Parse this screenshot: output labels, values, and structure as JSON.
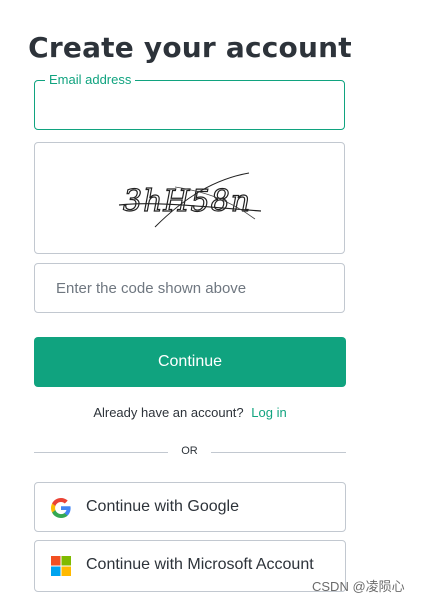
{
  "page": {
    "title": "Create your account"
  },
  "email": {
    "label": "Email address",
    "value": ""
  },
  "captcha": {
    "image_text": "3hH58n"
  },
  "code": {
    "placeholder": "Enter the code shown above",
    "value": ""
  },
  "continue_button": {
    "label": "Continue"
  },
  "login_prompt": {
    "text": "Already have an account?",
    "link": "Log in"
  },
  "divider": {
    "text": "OR"
  },
  "social": {
    "google_label": "Continue with Google",
    "microsoft_label": "Continue with Microsoft Account"
  },
  "watermark": {
    "text": "CSDN @凌陨心"
  },
  "colors": {
    "accent": "#10a37f",
    "text": "#2d333a",
    "border": "#c2c8d0"
  },
  "icons": [
    "google-icon",
    "microsoft-icon"
  ]
}
